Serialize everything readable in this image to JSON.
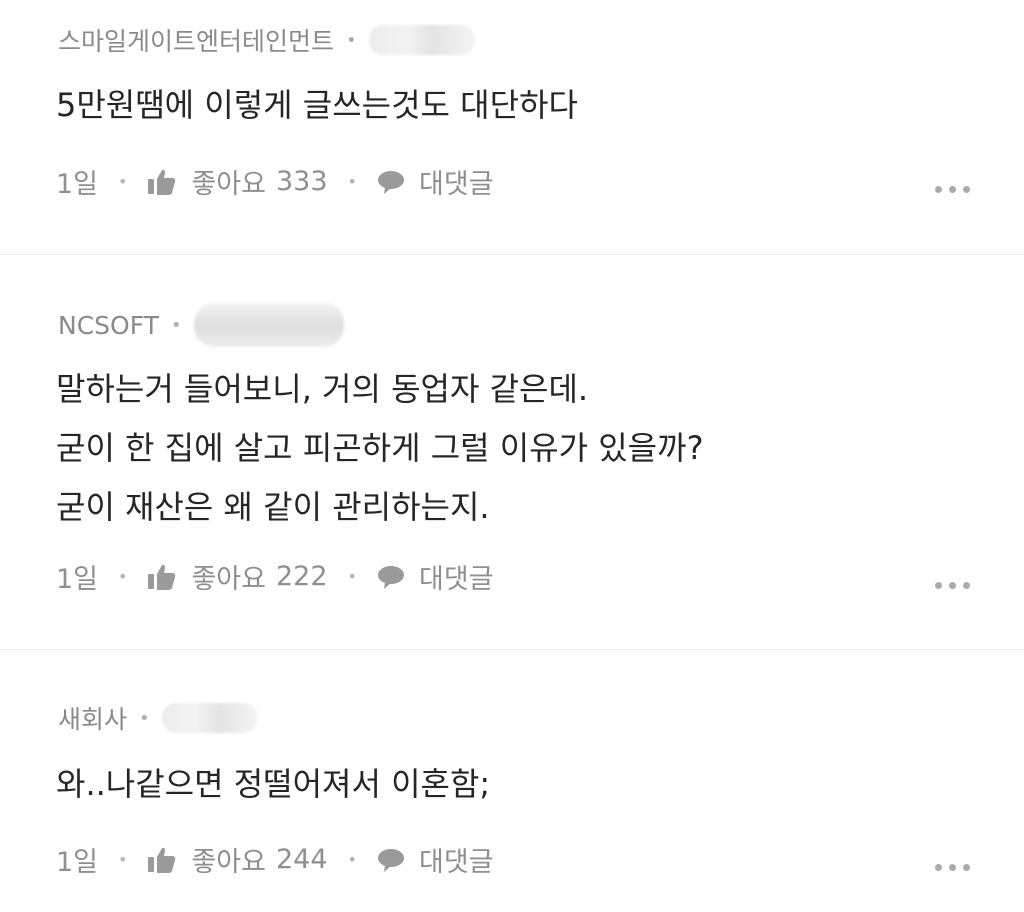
{
  "comments": [
    {
      "author": "스마일게이트엔터테인먼트",
      "text_lines": [
        "5만원땜에 이렇게 글쓰는것도 대단하다"
      ],
      "time": "1일",
      "like_label": "좋아요",
      "like_count": "333",
      "reply_label": "대댓글"
    },
    {
      "author": "NCSOFT",
      "text_lines": [
        "말하는거 들어보니, 거의 동업자 같은데.",
        "굳이 한 집에 살고 피곤하게 그럴 이유가 있을까?",
        "굳이 재산은 왜 같이 관리하는지."
      ],
      "time": "1일",
      "like_label": "좋아요",
      "like_count": "222",
      "reply_label": "대댓글"
    },
    {
      "author": "새회사",
      "text_lines": [
        "와..나같으면 정떨어져서 이혼함;"
      ],
      "time": "1일",
      "like_label": "좋아요",
      "like_count": "244",
      "reply_label": "대댓글"
    }
  ],
  "icons": {
    "like": "thumbs-up-icon",
    "reply": "speech-bubble-icon",
    "more": "more-dots-icon"
  },
  "colors": {
    "meta": "#8a8a8a",
    "text": "#262626",
    "divider": "#ebebeb"
  }
}
